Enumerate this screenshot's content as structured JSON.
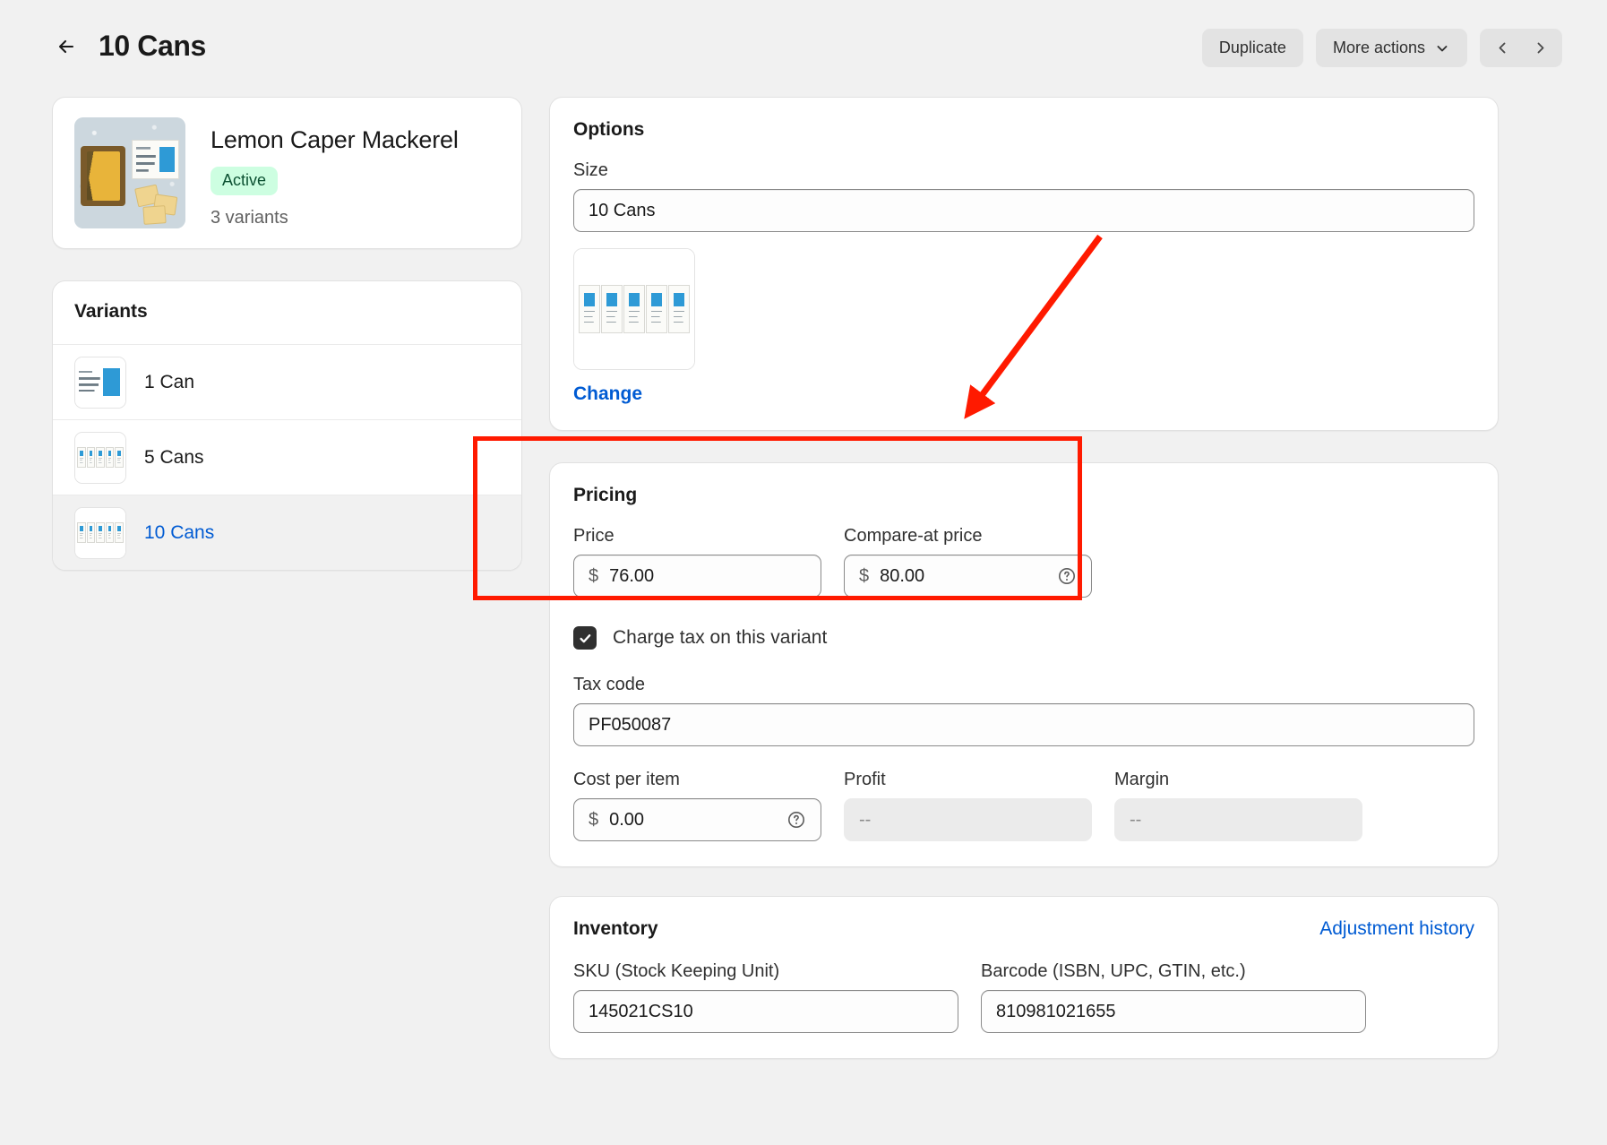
{
  "header": {
    "back_icon": "arrow-left-icon",
    "title": "10 Cans",
    "duplicate_label": "Duplicate",
    "more_actions_label": "More actions",
    "more_actions_icon": "chevron-down-icon",
    "prev_icon": "chevron-left-icon",
    "next_icon": "chevron-right-icon"
  },
  "product": {
    "thumb_icon": "product-photo",
    "name": "Lemon Caper Mackerel",
    "status_badge": "Active",
    "status_color": "#cdfee1",
    "variants_count": "3 variants"
  },
  "variants": {
    "title": "Variants",
    "items": [
      {
        "label": "1 Can",
        "selected": false
      },
      {
        "label": "5 Cans",
        "selected": false
      },
      {
        "label": "10 Cans",
        "selected": true
      }
    ]
  },
  "options": {
    "title": "Options",
    "size_label": "Size",
    "size_value": "10 Cans",
    "media_icon": "variant-image",
    "change_label": "Change"
  },
  "pricing": {
    "title": "Pricing",
    "price_label": "Price",
    "price_currency": "$",
    "price_value": "76.00",
    "compare_label": "Compare-at price",
    "compare_currency": "$",
    "compare_value": "80.00",
    "compare_help_icon": "question-circle-icon",
    "charge_tax_label": "Charge tax on this variant",
    "charge_tax_checked": true,
    "tax_code_label": "Tax code",
    "tax_code_value": "PF050087",
    "cost_label": "Cost per item",
    "cost_currency": "$",
    "cost_value": "0.00",
    "cost_help_icon": "question-circle-icon",
    "profit_label": "Profit",
    "profit_value": "--",
    "margin_label": "Margin",
    "margin_value": "--"
  },
  "inventory": {
    "title": "Inventory",
    "adjustment_history_label": "Adjustment history",
    "sku_label": "SKU (Stock Keeping Unit)",
    "sku_value": "145021CS10",
    "barcode_label": "Barcode (ISBN, UPC, GTIN, etc.)",
    "barcode_value": "810981021655"
  },
  "annotation": {
    "highlight_color": "#ff1a00",
    "arrow_icon": "pointer-arrow"
  }
}
